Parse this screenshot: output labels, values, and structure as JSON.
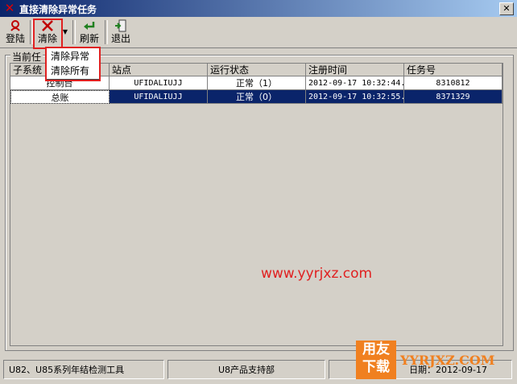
{
  "window": {
    "title": "直接清除异常任务",
    "close_glyph": "✕"
  },
  "toolbar": {
    "login_label": "登陆",
    "clear_label": "清除",
    "refresh_label": "刷新",
    "exit_label": "退出"
  },
  "clear_menu": {
    "items": [
      "清除异常",
      "清除所有"
    ]
  },
  "group": {
    "label": "当前任"
  },
  "table": {
    "columns": [
      "子系统",
      "站点",
      "运行状态",
      "注册时间",
      "任务号"
    ],
    "rows": [
      [
        "控制台",
        "UFIDALIUJJ",
        "正常（1）",
        "2012-09-17 10:32:44.",
        "8310812"
      ],
      [
        "总账",
        "UFIDALIUJJ",
        "正常（0）",
        "2012-09-17 10:32:55.",
        "8371329"
      ]
    ]
  },
  "watermark": "www.yyrjxz.com",
  "status": {
    "panel1": "U82、U85系列年结检测工具",
    "panel2": "U8产品支持部",
    "panel3": "日期：2012-09-17"
  },
  "logo": {
    "line1": "用友",
    "line2": "下载",
    "url": "YYRJXZ.COM"
  },
  "colors": {
    "titlebar": "#0a246a",
    "selection": "#0a246a",
    "highlight_box": "#e02020",
    "logo": "#f08020"
  },
  "icons": [
    "app-x-icon",
    "login-icon",
    "clear-x-icon",
    "refresh-arrow-icon",
    "exit-door-icon",
    "dropdown-arrow-icon"
  ]
}
